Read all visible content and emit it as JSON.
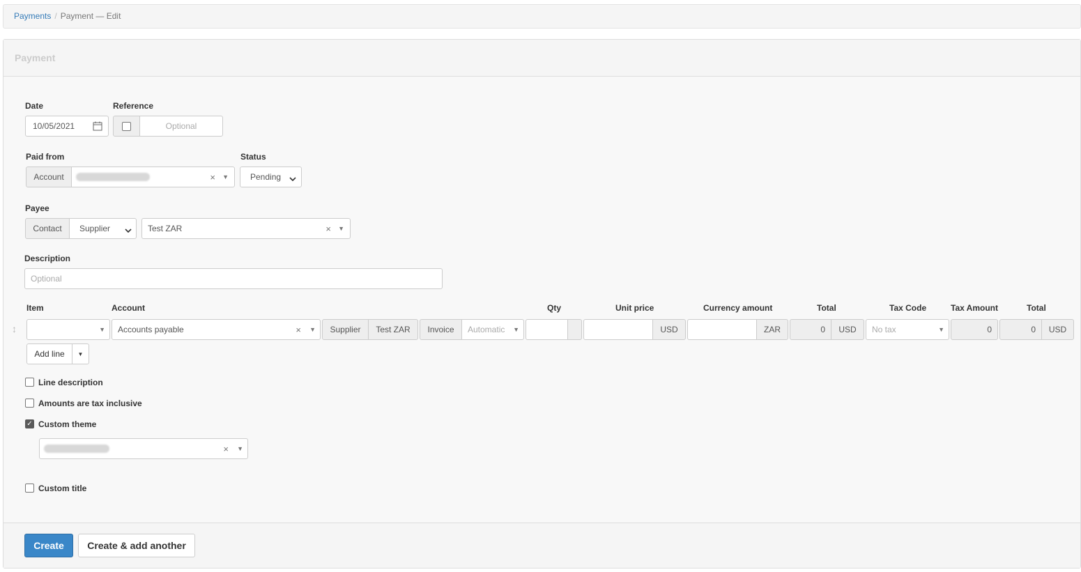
{
  "breadcrumb": {
    "parent": "Payments",
    "separator": "/",
    "current": "Payment — Edit"
  },
  "panel": {
    "title": "Payment"
  },
  "date": {
    "label": "Date",
    "value": "10/05/2021"
  },
  "reference": {
    "label": "Reference",
    "placeholder": "Optional"
  },
  "paid_from": {
    "label": "Paid from",
    "addon": "Account"
  },
  "status": {
    "label": "Status",
    "value": "Pending"
  },
  "payee": {
    "label": "Payee",
    "addon": "Contact",
    "type": "Supplier",
    "value": "Test ZAR"
  },
  "description": {
    "label": "Description",
    "placeholder": "Optional"
  },
  "lines": {
    "headers": {
      "item": "Item",
      "account": "Account",
      "qty": "Qty",
      "unit_price": "Unit price",
      "currency_amount": "Currency amount",
      "total": "Total",
      "tax_code": "Tax Code",
      "tax_amount": "Tax Amount",
      "total2": "Total"
    },
    "row": {
      "account": "Accounts payable",
      "supplier_addon": "Supplier",
      "supplier_value": "Test ZAR",
      "invoice_addon": "Invoice",
      "invoice_placeholder": "Automatic",
      "unit_currency": "USD",
      "amount_currency": "ZAR",
      "total_value": "0",
      "total_currency": "USD",
      "tax_placeholder": "No tax",
      "tax_amount": "0",
      "total2_value": "0",
      "total2_currency": "USD"
    },
    "add_line": "Add line"
  },
  "options": {
    "line_description": "Line description",
    "tax_inclusive": "Amounts are tax inclusive",
    "custom_theme": "Custom theme",
    "custom_title": "Custom title"
  },
  "icons": {
    "clear": "×",
    "caret": "▼",
    "check": "✓",
    "drag": "↕"
  },
  "footer": {
    "create": "Create",
    "create_another": "Create & add another"
  },
  "colors": {
    "primary": "#3a87c8",
    "link": "#337ab7"
  }
}
